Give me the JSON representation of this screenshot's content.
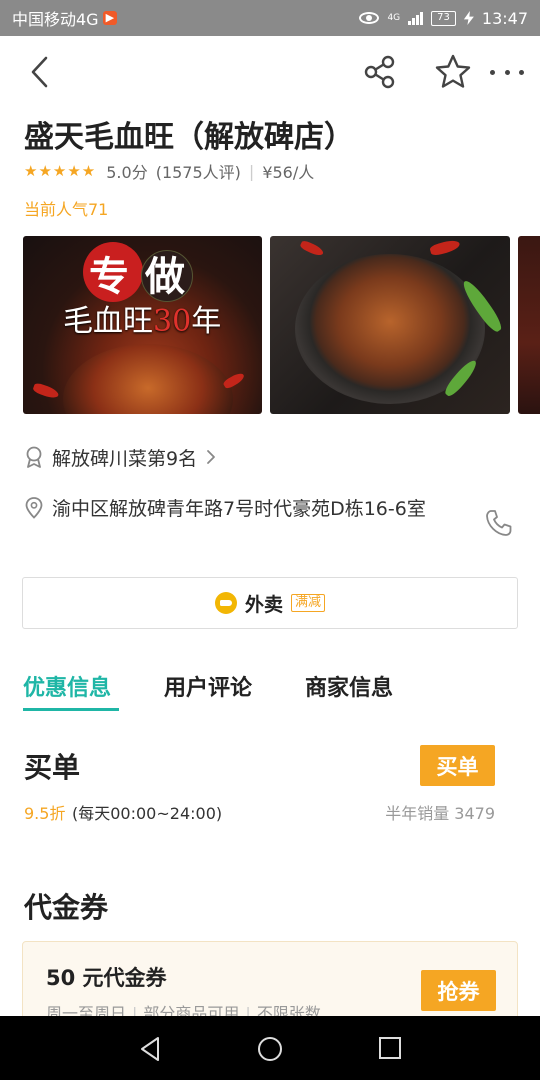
{
  "status_bar": {
    "carrier": "中国移动4G",
    "network": "4G",
    "battery": "73",
    "time": "13:47"
  },
  "restaurant": {
    "name": "盛天毛血旺（解放碑店）",
    "score": "5.0分",
    "reviews": "(1575人评)",
    "price_per_person": "¥56/人",
    "popularity": "当前人气71"
  },
  "gallery": {
    "photo1_seal_1": "专",
    "photo1_seal_2": "做",
    "photo1_caption_text": "毛血旺",
    "photo1_caption_number": "30",
    "photo1_caption_suffix": "年"
  },
  "ranking": {
    "label": "解放碑川菜第9名"
  },
  "address": {
    "text": "渝中区解放碑青年路7号时代豪苑D栋16-6室"
  },
  "takeaway": {
    "label": "外卖",
    "tag": "满减"
  },
  "tabs": [
    {
      "label": "优惠信息",
      "active": true
    },
    {
      "label": "用户评论",
      "active": false
    },
    {
      "label": "商家信息",
      "active": false
    }
  ],
  "buy_section": {
    "title": "买单",
    "button": "买单",
    "discount": "9.5折",
    "hours": "(每天00:00~24:00)",
    "sales": "半年销量 3479"
  },
  "voucher_section": {
    "title": "代金券",
    "coupon": {
      "name": "50 元代金券",
      "terms": [
        "周一至周日",
        "部分商品可用",
        "不限张数"
      ],
      "button": "抢券"
    }
  },
  "colors": {
    "accent_teal": "#1fb6a6",
    "accent_orange": "#f5a623",
    "status_bar": "#8a8a8a"
  },
  "icons": [
    "back-icon",
    "share-icon",
    "star-icon",
    "more-icon",
    "award-icon",
    "chevron-right-icon",
    "location-icon",
    "phone-icon",
    "takeaway-logo-icon",
    "nav-back-icon",
    "nav-home-icon",
    "nav-recent-icon"
  ]
}
